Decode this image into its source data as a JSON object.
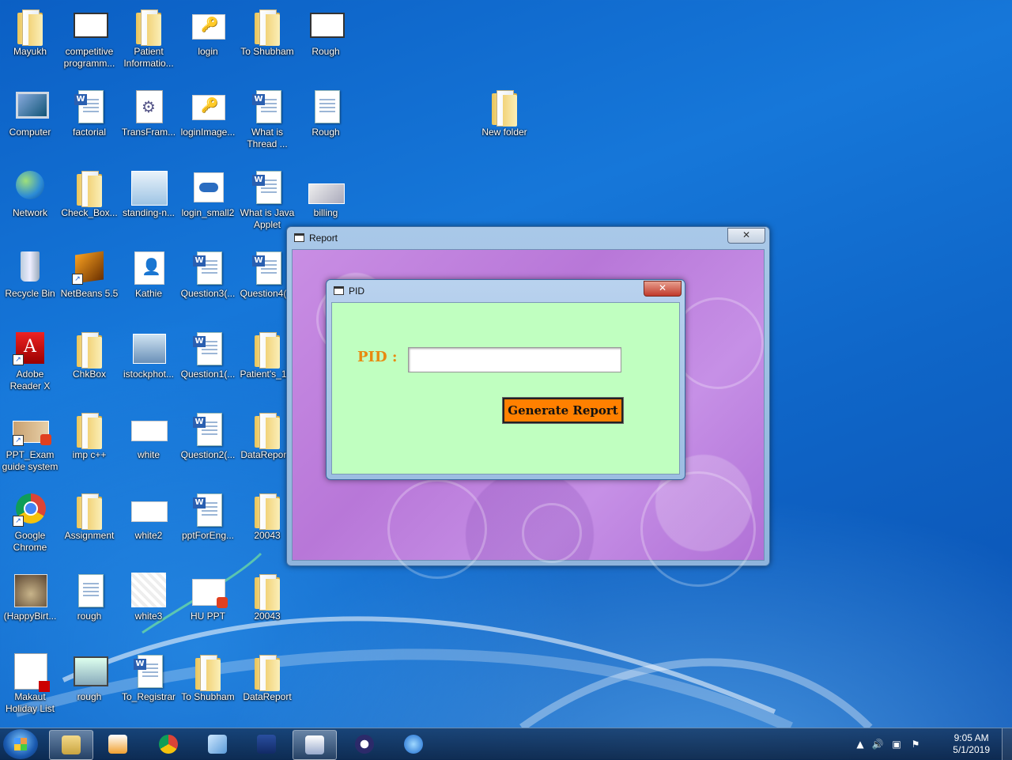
{
  "desktop": {
    "icons": [
      {
        "label": "Mayukh",
        "kind": "folder-user-icon"
      },
      {
        "label": "competitive programm...",
        "kind": "screenshot-icon"
      },
      {
        "label": "Patient Informatio...",
        "kind": "folder-icon"
      },
      {
        "label": "login",
        "kind": "image-icon"
      },
      {
        "label": "To Shubham",
        "kind": "folder-icon"
      },
      {
        "label": "Rough",
        "kind": "app-icon"
      },
      {
        "label": "Computer",
        "kind": "computer-icon"
      },
      {
        "label": "factorial",
        "kind": "word-doc-icon"
      },
      {
        "label": "TransFram...",
        "kind": "settings-file-icon"
      },
      {
        "label": "loginImage...",
        "kind": "image-icon"
      },
      {
        "label": "What is Thread ...",
        "kind": "word-doc-icon"
      },
      {
        "label": "Rough",
        "kind": "text-file-icon"
      },
      {
        "label": "New folder",
        "kind": "folder-icon"
      },
      {
        "label": "Network",
        "kind": "network-icon"
      },
      {
        "label": "Check_Box...",
        "kind": "zip-folder-icon"
      },
      {
        "label": "standing-n...",
        "kind": "image-icon"
      },
      {
        "label": "login_small2",
        "kind": "image-icon"
      },
      {
        "label": "What is Java Applet",
        "kind": "word-doc-icon"
      },
      {
        "label": "billing",
        "kind": "image-icon"
      },
      {
        "label": "Recycle Bin",
        "kind": "recycle-bin-icon"
      },
      {
        "label": "NetBeans 5.5",
        "kind": "netbeans-icon"
      },
      {
        "label": "Kathie",
        "kind": "image-icon"
      },
      {
        "label": "Question3(...",
        "kind": "word-doc-icon"
      },
      {
        "label": "Question4(...",
        "kind": "word-doc-icon"
      },
      {
        "label": "Adobe Reader X",
        "kind": "adobe-reader-icon"
      },
      {
        "label": "ChkBox",
        "kind": "zip-folder-icon"
      },
      {
        "label": "istockphot...",
        "kind": "image-icon"
      },
      {
        "label": "Question1(...",
        "kind": "word-doc-icon"
      },
      {
        "label": "Patient's_1...",
        "kind": "zip-folder-icon"
      },
      {
        "label": "PPT_Exam guide system",
        "kind": "ppt-image-icon"
      },
      {
        "label": "imp c++",
        "kind": "zip-folder-icon"
      },
      {
        "label": "white",
        "kind": "blank-image-icon"
      },
      {
        "label": "Question2(...",
        "kind": "word-doc-icon"
      },
      {
        "label": "DataRepor...",
        "kind": "zip-folder-icon"
      },
      {
        "label": "Google Chrome",
        "kind": "chrome-icon"
      },
      {
        "label": "Assignment",
        "kind": "zip-folder-icon"
      },
      {
        "label": "white2",
        "kind": "blank-image-icon"
      },
      {
        "label": "pptForEng...",
        "kind": "word-doc-icon"
      },
      {
        "label": "20043",
        "kind": "zip-folder-icon"
      },
      {
        "label": "(HappyBirt...",
        "kind": "image-icon"
      },
      {
        "label": "rough",
        "kind": "text-file-icon"
      },
      {
        "label": "white3",
        "kind": "texture-image-icon"
      },
      {
        "label": "HU PPT",
        "kind": "ppt-image-icon"
      },
      {
        "label": "20043",
        "kind": "zip-folder-icon"
      },
      {
        "label": "Makaut Holiday List",
        "kind": "pdf-icon"
      },
      {
        "label": "rough",
        "kind": "image-icon"
      },
      {
        "label": "To_Registrar",
        "kind": "word-doc-icon"
      },
      {
        "label": "To Shubham",
        "kind": "zip-folder-icon"
      },
      {
        "label": "DataReport",
        "kind": "folder-icon"
      }
    ]
  },
  "report_window": {
    "title": "Report",
    "close_label": "✕"
  },
  "pid_dialog": {
    "title": "PID",
    "close_label": "✕",
    "pid_label": "PID :",
    "pid_value": "",
    "pid_placeholder": "",
    "generate_label": "Generate Report"
  },
  "taskbar": {
    "items": [
      {
        "name": "file-explorer-icon",
        "active": true
      },
      {
        "name": "media-player-icon",
        "active": false
      },
      {
        "name": "chrome-icon",
        "active": false
      },
      {
        "name": "notepad-icon",
        "active": false
      },
      {
        "name": "dev-cpp-icon",
        "active": false
      },
      {
        "name": "vb6-report-app-icon",
        "active": true
      },
      {
        "name": "eclipse-icon",
        "active": false
      },
      {
        "name": "internet-explorer-icon",
        "active": false
      }
    ],
    "clock_time": "9:05 AM",
    "clock_date": "5/1/2019"
  },
  "colors": {
    "accent_orange": "#ff8000",
    "pid_label_color": "#e88a10",
    "dialog_bg": "#c0ffc0"
  }
}
